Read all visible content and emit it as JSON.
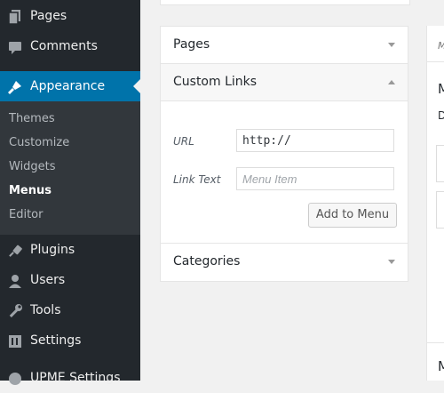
{
  "sidebar": {
    "menu": [
      {
        "label": "Pages",
        "icon": "pages-icon"
      },
      {
        "label": "Comments",
        "icon": "comments-icon"
      },
      {
        "label": "Appearance",
        "icon": "appearance-brush-icon"
      },
      {
        "label": "Plugins",
        "icon": "plugins-icon"
      },
      {
        "label": "Users",
        "icon": "users-icon"
      },
      {
        "label": "Tools",
        "icon": "tools-icon"
      },
      {
        "label": "Settings",
        "icon": "settings-icon"
      },
      {
        "label": "UPME Settings",
        "icon": "upme-settings-icon"
      }
    ],
    "submenu": [
      "Themes",
      "Customize",
      "Widgets",
      "Menus",
      "Editor"
    ],
    "current_submenu": "Menus"
  },
  "panels": {
    "pages_title": "Pages",
    "custom_links_title": "Custom Links",
    "url_label": "URL",
    "url_value": "http://",
    "link_text_label": "Link Text",
    "link_text_placeholder": "Menu Item",
    "add_button": "Add to Menu",
    "categories_title": "Categories"
  },
  "right_panel": {
    "tab_text": "M",
    "heading": "M",
    "sub": "D",
    "bottom_heading": "M"
  },
  "colors": {
    "sidebar_bg": "#23282d",
    "submenu_bg": "#32373c",
    "active_bg": "#0073aa"
  }
}
